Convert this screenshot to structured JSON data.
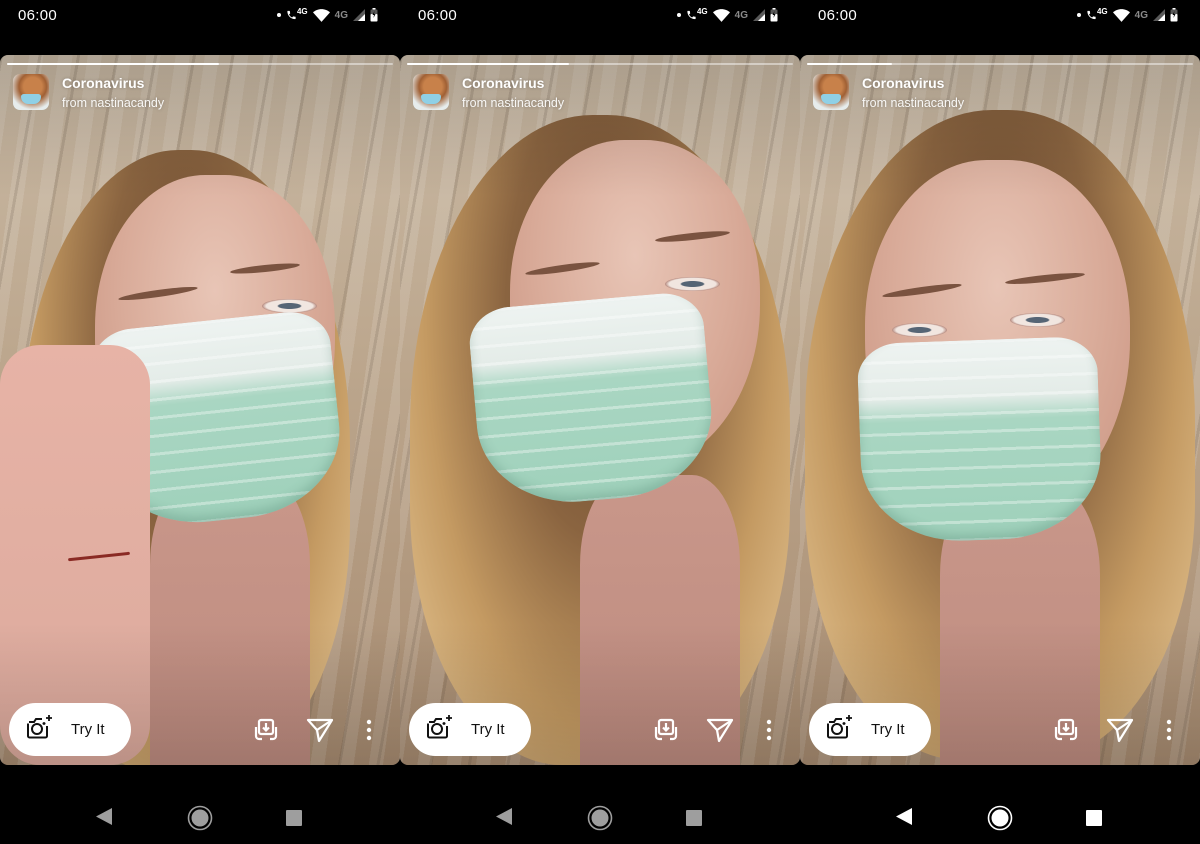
{
  "panels": [
    {
      "status_bar": {
        "time": "06:00",
        "network_label_1": "4G",
        "network_label_2": "4G"
      },
      "story": {
        "progress_percent": 55,
        "effect_title": "Coronavirus",
        "effect_subtitle": "from nastinacandy",
        "try_button_label": "Try It"
      },
      "icons": [
        "camera-sparkle-icon",
        "save-effect-icon",
        "send-icon",
        "more-vertical-icon"
      ],
      "nav": {
        "style": "dimmed"
      }
    },
    {
      "status_bar": {
        "time": "06:00",
        "network_label_1": "4G",
        "network_label_2": "4G"
      },
      "story": {
        "progress_percent": 42,
        "effect_title": "Coronavirus",
        "effect_subtitle": "from nastinacandy",
        "try_button_label": "Try It"
      },
      "icons": [
        "camera-sparkle-icon",
        "save-effect-icon",
        "send-icon",
        "more-vertical-icon"
      ],
      "nav": {
        "style": "dimmed"
      }
    },
    {
      "status_bar": {
        "time": "06:00",
        "network_label_1": "4G",
        "network_label_2": "4G"
      },
      "story": {
        "progress_percent": 22,
        "effect_title": "Coronavirus",
        "effect_subtitle": "from nastinacandy",
        "try_button_label": "Try It"
      },
      "icons": [
        "camera-sparkle-icon",
        "save-effect-icon",
        "send-icon",
        "more-vertical-icon"
      ],
      "nav": {
        "style": "bright"
      }
    }
  ],
  "colors": {
    "background": "#000000",
    "button_bg": "#ffffff",
    "nav_dimmed": "#9e9e9e",
    "nav_bright": "#ffffff",
    "mask_green": "#9fd1bb"
  }
}
